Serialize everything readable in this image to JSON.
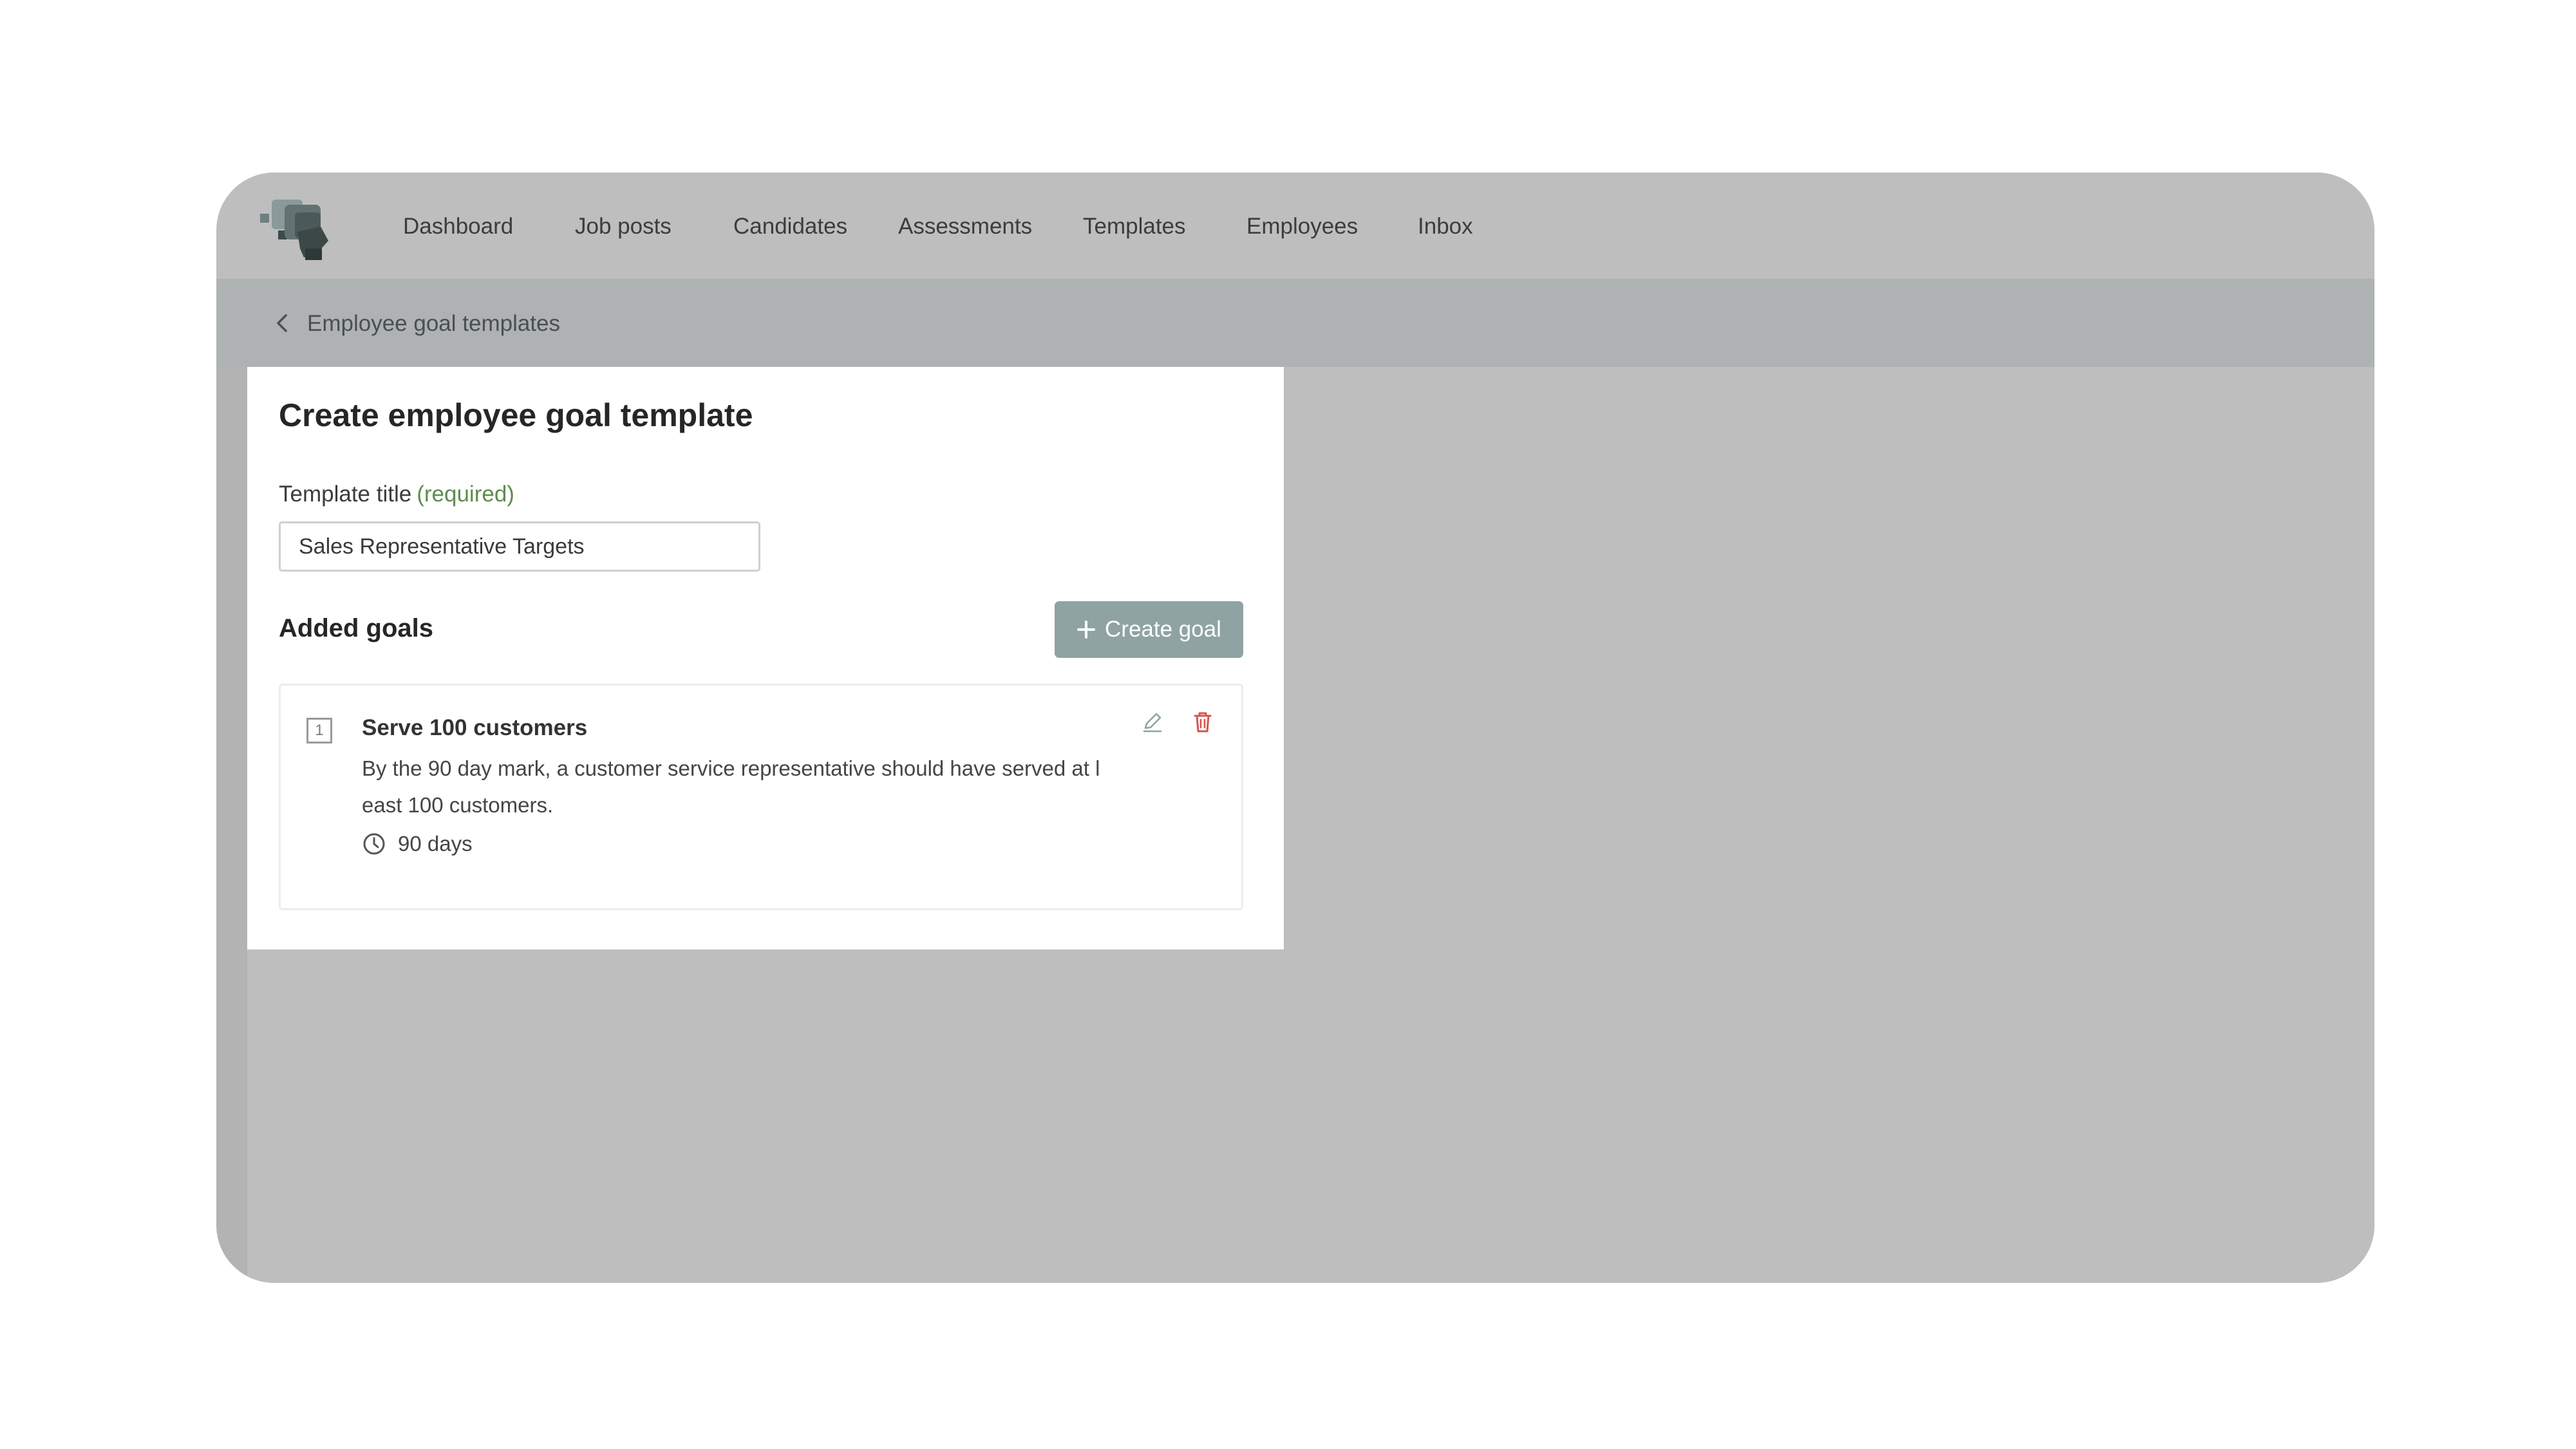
{
  "nav": {
    "items": [
      {
        "label": "Dashboard"
      },
      {
        "label": "Job posts"
      },
      {
        "label": "Candidates"
      },
      {
        "label": "Assessments"
      },
      {
        "label": "Templates"
      },
      {
        "label": "Employees"
      },
      {
        "label": "Inbox"
      }
    ]
  },
  "breadcrumb": {
    "back_label": "Employee goal templates"
  },
  "form": {
    "title": "Create employee goal template",
    "template_title_label": "Template title",
    "required_label": "(required)",
    "template_title_value": "Sales Representative Targets",
    "added_goals_label": "Added goals",
    "create_goal_label": "Create goal"
  },
  "goals": [
    {
      "number": "1",
      "title": "Serve 100 customers",
      "description": "By the 90 day mark, a customer service representative should have served at least 100 customers.",
      "duration": "90 days"
    }
  ],
  "colors": {
    "accent_button": "#8fa3a3",
    "required_text": "#5f8c4e",
    "delete_icon": "#d9534f",
    "subheader_bg": "#aeb2b2",
    "overlay_bg": "#bebebe"
  },
  "icons": {
    "logo": "brand-logo",
    "back": "chevron-left-icon",
    "plus": "plus-icon",
    "edit": "pencil-icon",
    "delete": "trash-icon",
    "duration": "clock-icon"
  }
}
